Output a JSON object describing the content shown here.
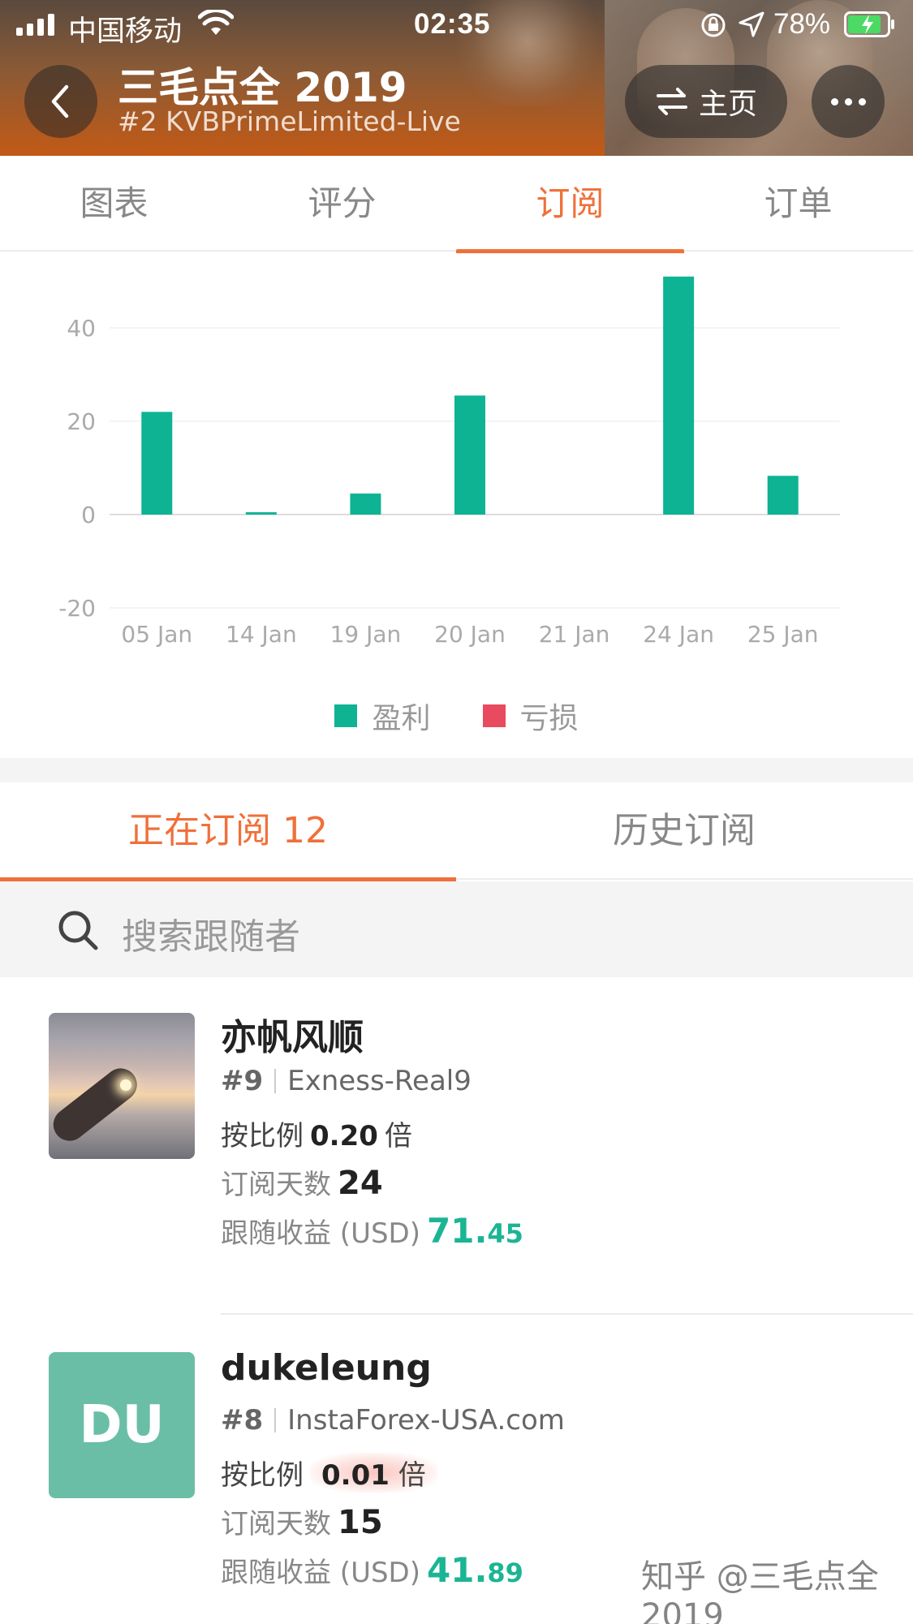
{
  "status_bar": {
    "carrier": "中国移动",
    "time": "02:35",
    "battery_percent": "78%"
  },
  "header": {
    "title": "三毛点全 2019",
    "subtitle": "#2 KVBPrimeLimited-Live",
    "home_label": "主页"
  },
  "top_tabs": [
    "图表",
    "评分",
    "订阅",
    "订单"
  ],
  "top_tab_active": 2,
  "chart_data": {
    "type": "bar",
    "categories": [
      "05 Jan",
      "14 Jan",
      "19 Jan",
      "20 Jan",
      "21 Jan",
      "24 Jan",
      "25 Jan"
    ],
    "series": [
      {
        "name": "盈利",
        "values": [
          22,
          0.5,
          4.5,
          25.5,
          0,
          51,
          8.3
        ],
        "color": "#0db393"
      },
      {
        "name": "亏损",
        "values": [
          0,
          0,
          0,
          0,
          0,
          0,
          0
        ],
        "color": "#e84a5f"
      }
    ],
    "yticks": [
      "40",
      "20",
      "0",
      "-20"
    ],
    "ylim": [
      -20,
      50
    ],
    "grid": true,
    "legend": "bottom"
  },
  "sub_tabs": {
    "current": "正在订阅 12",
    "history": "历史订阅"
  },
  "search": {
    "placeholder": "搜索跟随者"
  },
  "subscribers": [
    {
      "name": "亦帆风顺",
      "rank": "#9",
      "broker": "Exness-Real9",
      "ratio_label": "按比例",
      "ratio_value": "0.20",
      "ratio_unit": "倍",
      "days_label": "订阅天数",
      "days_value": "24",
      "profit_label": "跟随收益 (USD)",
      "profit_int": "71.",
      "profit_dec": "45",
      "avatar": "photo"
    },
    {
      "name": "dukeleung",
      "rank": "#8",
      "broker": "InstaForex-USA.com",
      "ratio_label": "按比例",
      "ratio_value": "0.01",
      "ratio_unit": "倍",
      "days_label": "订阅天数",
      "days_value": "15",
      "profit_label": "跟随收益 (USD)",
      "profit_int": "41.",
      "profit_dec": "89",
      "avatar": "DU",
      "avatar_color": "#6bbea6"
    }
  ],
  "watermark": "知乎 @三毛点全2019",
  "colors": {
    "accent": "#f0703a",
    "profit": "#0db393",
    "loss": "#e84a5f"
  }
}
